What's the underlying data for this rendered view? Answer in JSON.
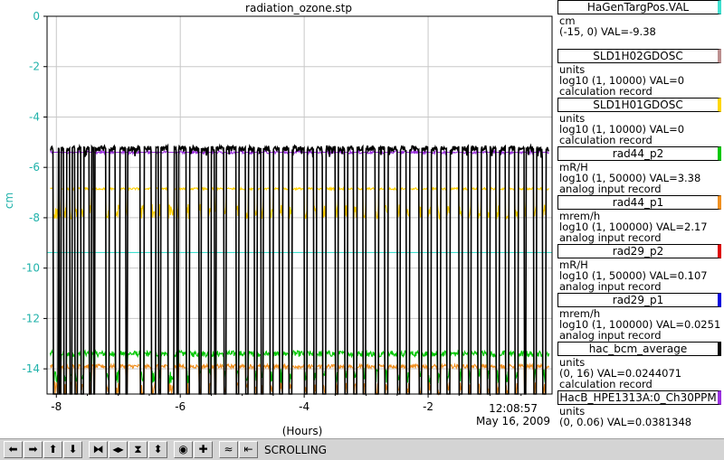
{
  "window": {
    "title": "radiation_ozone.stp"
  },
  "chart_data": {
    "type": "line",
    "title": "radiation_ozone.stp",
    "xlabel": "(Hours)",
    "ylabel": "cm",
    "xlim": [
      -8.15,
      0
    ],
    "ylim": [
      -15,
      0
    ],
    "x_ticks": [
      -8,
      -6,
      -4,
      -2
    ],
    "y_ticks": [
      0,
      -2,
      -4,
      -6,
      -8,
      -10,
      -12,
      -14
    ],
    "end_time": "12:08:57",
    "end_date": "May 16, 2009",
    "grid": true,
    "series": [
      {
        "name": "HaGenTargPos.VAL",
        "color": "#40e0d0",
        "kind": "constant",
        "value": -9.38
      },
      {
        "name": "rad44_p2",
        "color": "#00c800",
        "kind": "noisy",
        "base": -13.4,
        "noise": 0.12
      },
      {
        "name": "rad44_p1",
        "color": "#f09020",
        "kind": "noisy",
        "base": -13.9,
        "noise": 0.08
      },
      {
        "name": "rad29_p2",
        "color": "#ffd000",
        "kind": "noisy",
        "base": -6.85,
        "noise": 0.04
      },
      {
        "name": "HacB_HPE1313A:0_Ch30PPM",
        "color": "#9b30e0",
        "kind": "noisy",
        "base": -5.4,
        "noise": 0.06
      },
      {
        "name": "hac_bcm_average",
        "color": "#000000",
        "kind": "beam",
        "on": -5.25,
        "off": -15,
        "noise": 0.1
      }
    ],
    "beam_off_periods_hours": [
      [
        -8.05,
        -7.97
      ],
      [
        -7.95,
        -7.93
      ],
      [
        -7.88,
        -7.84
      ],
      [
        -7.78,
        -7.75
      ],
      [
        -7.7,
        -7.66
      ],
      [
        -7.6,
        -7.56
      ],
      [
        -7.47,
        -7.43
      ],
      [
        -7.4,
        -7.38
      ],
      [
        -7.2,
        -7.15
      ],
      [
        -7.05,
        -6.98
      ],
      [
        -6.88,
        -6.85
      ],
      [
        -6.65,
        -6.58
      ],
      [
        -6.47,
        -6.4
      ],
      [
        -6.35,
        -6.32
      ],
      [
        -6.2,
        -6.1
      ],
      [
        -6.06,
        -6.03
      ],
      [
        -5.9,
        -5.85
      ],
      [
        -5.7,
        -5.66
      ],
      [
        -5.55,
        -5.5
      ],
      [
        -5.45,
        -5.42
      ],
      [
        -5.3,
        -5.26
      ],
      [
        -5.1,
        -5.05
      ],
      [
        -4.95,
        -4.9
      ],
      [
        -4.8,
        -4.76
      ],
      [
        -4.7,
        -4.66
      ],
      [
        -4.55,
        -4.5
      ],
      [
        -4.4,
        -4.35
      ],
      [
        -4.25,
        -4.2
      ],
      [
        -4.0,
        -3.95
      ],
      [
        -3.85,
        -3.8
      ],
      [
        -3.7,
        -3.65
      ],
      [
        -3.5,
        -3.45
      ],
      [
        -3.35,
        -3.3
      ],
      [
        -3.2,
        -3.15
      ],
      [
        -3.05,
        -3.01
      ],
      [
        -2.85,
        -2.8
      ],
      [
        -2.7,
        -2.65
      ],
      [
        -2.5,
        -2.45
      ],
      [
        -2.35,
        -2.3
      ],
      [
        -2.15,
        -2.1
      ],
      [
        -2.0,
        -1.95
      ],
      [
        -1.85,
        -1.8
      ],
      [
        -1.7,
        -1.65
      ],
      [
        -1.5,
        -1.45
      ],
      [
        -1.35,
        -1.31
      ],
      [
        -1.2,
        -1.15
      ],
      [
        -1.05,
        -1.0
      ],
      [
        -0.9,
        -0.85
      ],
      [
        -0.75,
        -0.7
      ],
      [
        -0.6,
        -0.55
      ],
      [
        -0.45,
        -0.42
      ],
      [
        -0.3,
        -0.25
      ],
      [
        -0.15,
        -0.1
      ]
    ]
  },
  "legend": [
    {
      "name": "HaGenTargPos.VAL",
      "color": "#40e0d0",
      "units": "cm",
      "range": "(-15, 0) VAL=-9.38",
      "record": ""
    },
    {
      "name": "SLD1H02GDOSC",
      "color": "#bc8f8f",
      "units": "units",
      "range": "log10 (1, 10000)  VAL=0",
      "record": "calculation record"
    },
    {
      "name": "SLD1H01GDOSC",
      "color": "#ffd700",
      "units": "units",
      "range": "log10 (1, 10000) VAL=0",
      "record": "calculation record"
    },
    {
      "name": "rad44_p2",
      "color": "#00c800",
      "units": "mR/H",
      "range": "log10 (1, 50000) VAL=3.38",
      "record": "analog input record"
    },
    {
      "name": "rad44_p1",
      "color": "#f09020",
      "units": "mrem/h",
      "range": "log10 (1, 100000) VAL=2.17",
      "record": "analog input record"
    },
    {
      "name": "rad29_p2",
      "color": "#e00000",
      "units": "mR/H",
      "range": "log10 (1, 50000) VAL=0.107",
      "record": "analog input record"
    },
    {
      "name": "rad29_p1",
      "color": "#0000e0",
      "units": "mrem/h",
      "range": "log10 (1, 100000) VAL=0.0251",
      "record": "analog input record"
    },
    {
      "name": "hac_bcm_average",
      "color": "#000000",
      "units": "units",
      "range": "(0, 16) VAL=0.0244071",
      "record": "calculation record"
    },
    {
      "name": "HacB_HPE1313A:0_Ch30PPM",
      "color": "#9b30e0",
      "units": "units",
      "range": "(0, 0.06) VAL=0.0381348",
      "record": ""
    }
  ],
  "toolbar": {
    "status": "SCROLLING",
    "buttons": [
      {
        "name": "pan-left-icon",
        "glyph": "⬅"
      },
      {
        "name": "pan-right-icon",
        "glyph": "➡"
      },
      {
        "name": "pan-up-icon",
        "glyph": "⬆"
      },
      {
        "name": "pan-down-icon",
        "glyph": "⬇"
      },
      {
        "name": "zoom-in-horizontal-icon",
        "glyph": "⧓"
      },
      {
        "name": "zoom-out-horizontal-icon",
        "glyph": "◀▶"
      },
      {
        "name": "zoom-in-vertical-icon",
        "glyph": "⧗"
      },
      {
        "name": "zoom-out-vertical-icon",
        "glyph": "⬍"
      },
      {
        "name": "autoscale-icon",
        "glyph": "◉"
      },
      {
        "name": "reset-icon",
        "glyph": "✚"
      },
      {
        "name": "styles-icon",
        "glyph": "≈"
      },
      {
        "name": "scroll-mode-icon",
        "glyph": "⇤"
      }
    ]
  }
}
